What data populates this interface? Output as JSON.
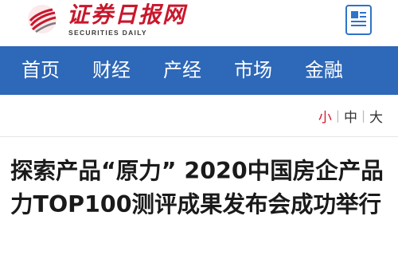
{
  "header": {
    "logo_text_cn": "证券日报网",
    "logo_text_en": "SECURITIES DAILY",
    "accent_color": "#c9172c"
  },
  "nav": {
    "background": "#2e68b8",
    "items": [
      {
        "label": "首页"
      },
      {
        "label": "财经"
      },
      {
        "label": "产经"
      },
      {
        "label": "市场"
      },
      {
        "label": "金融"
      }
    ]
  },
  "font_size_switch": {
    "options": [
      "小",
      "中",
      "大"
    ],
    "separator": "|",
    "selected": "小"
  },
  "article": {
    "title": "探索产品“原力” 2020中国房企产品力TOP100测评成果发布会成功举行"
  }
}
